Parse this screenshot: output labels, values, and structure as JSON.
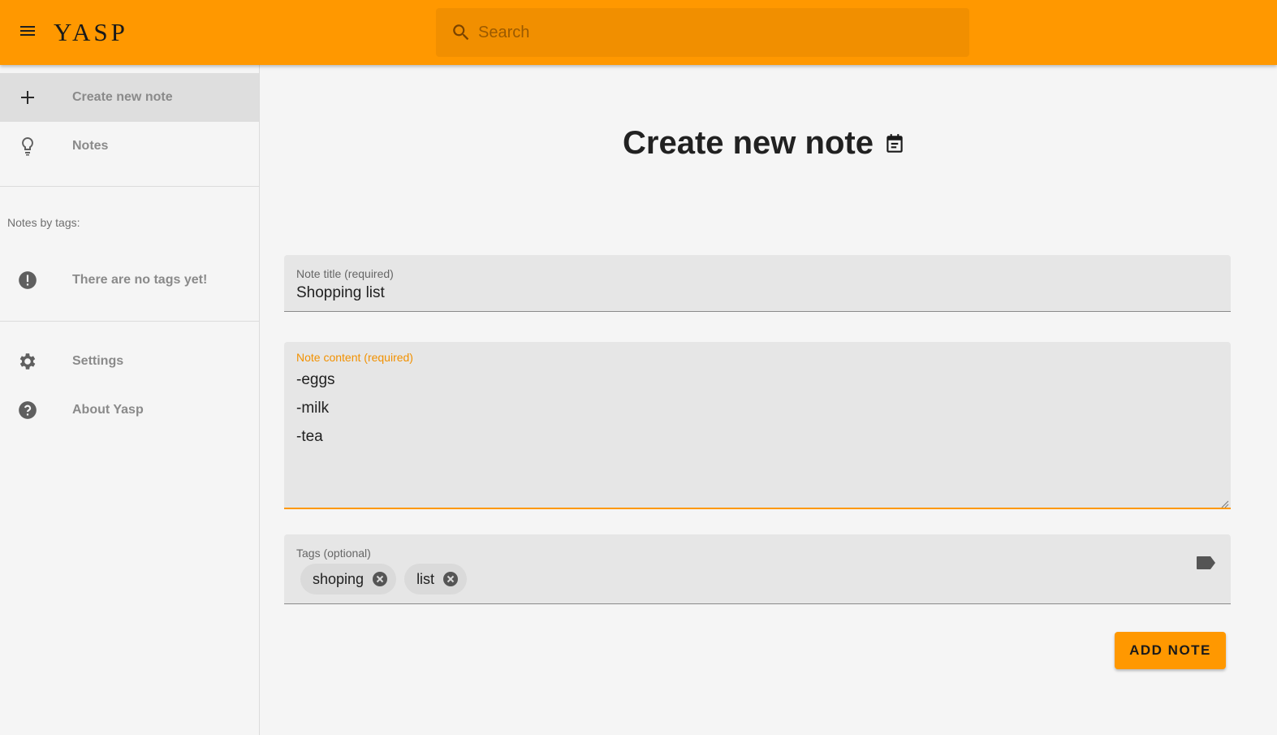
{
  "app": {
    "logo": "YASP"
  },
  "search": {
    "placeholder": "Search",
    "icon": "search-icon"
  },
  "sidebar": {
    "items": [
      {
        "label": "Create new note",
        "icon": "plus-icon",
        "active": true
      },
      {
        "label": "Notes",
        "icon": "lightbulb-icon",
        "active": false
      }
    ],
    "tags_section": {
      "heading": "Notes by tags:",
      "empty_message": "There are no tags yet!",
      "empty_icon": "alert-circle-icon"
    },
    "bottom_items": [
      {
        "label": "Settings",
        "icon": "gear-icon"
      },
      {
        "label": "About Yasp",
        "icon": "help-circle-icon"
      }
    ]
  },
  "main": {
    "title": "Create new note",
    "title_icon": "calendar-note-icon",
    "form": {
      "title_field": {
        "label": "Note title (required)",
        "value": "Shopping list"
      },
      "content_field": {
        "label": "Note content (required)",
        "lines": [
          "-eggs",
          "-milk",
          "-tea"
        ]
      },
      "tags_field": {
        "label": "Tags (optional)",
        "chips": [
          {
            "label": "shoping"
          },
          {
            "label": "list"
          }
        ],
        "icon": "tag-icon"
      },
      "submit_label": "ADD NOTE"
    }
  },
  "colors": {
    "primary": "#ff9800",
    "search_bg": "#f18f00",
    "active_nav": "#dedede",
    "field_bg": "#e6e6e6"
  }
}
